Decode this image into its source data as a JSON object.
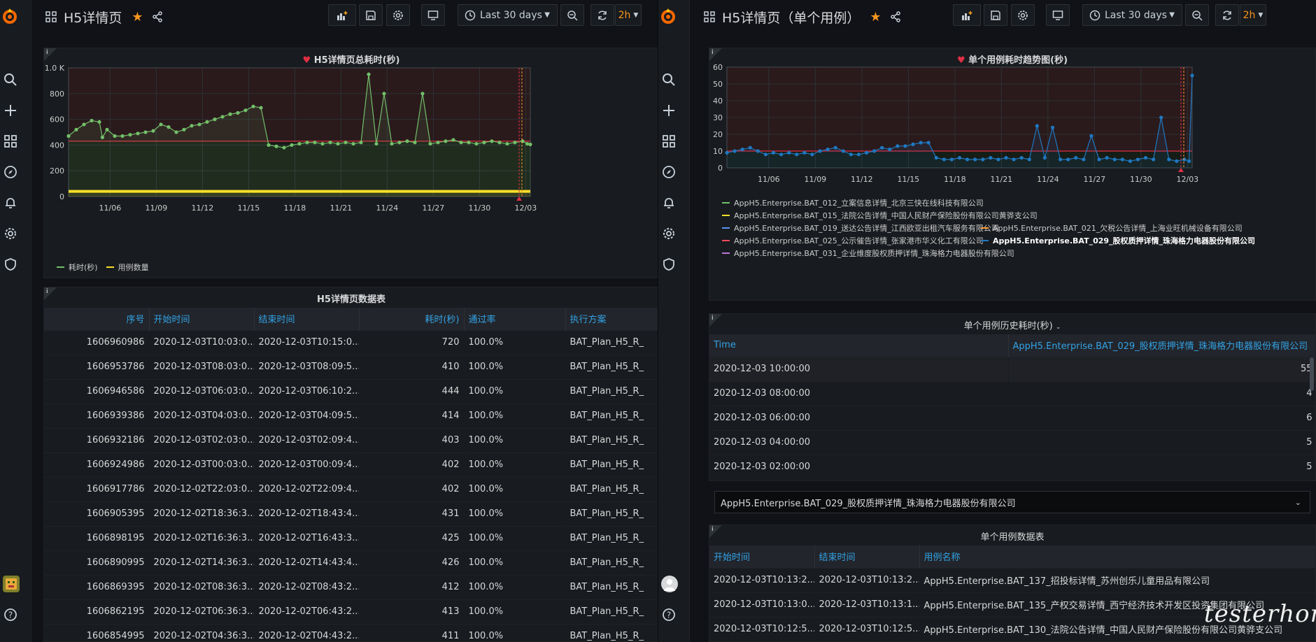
{
  "left": {
    "title": "H5详情页",
    "time_range": "Last 30 days",
    "refresh": "2h",
    "chart1": {
      "title": "H5详情页总耗时(秒)",
      "chart_data": {
        "type": "line",
        "title": "H5详情页总耗时(秒)",
        "x_ticks": [
          "11/06",
          "11/09",
          "11/12",
          "11/15",
          "11/18",
          "11/21",
          "11/24",
          "11/27",
          "11/30",
          "12/03"
        ],
        "y_ticks": [
          "0",
          "200",
          "400",
          "600",
          "800",
          "1.0 K"
        ],
        "ylim": [
          0,
          1000
        ],
        "threshold": 430,
        "series": [
          {
            "name": "耗时(秒)",
            "color": "#73bf69",
            "x": [
              0,
              0.5,
              1,
              1.5,
              2,
              2.2,
              2.5,
              3,
              3.5,
              4,
              4.5,
              5,
              5.5,
              6,
              6.5,
              7,
              7.5,
              8,
              8.5,
              9,
              9.5,
              10,
              10.5,
              11,
              11.5,
              12,
              12.5,
              13,
              13.5,
              14,
              14.5,
              15,
              15.5,
              16,
              16.5,
              17,
              17.5,
              18,
              18.5,
              19,
              19.5,
              20,
              20.5,
              21,
              21.5,
              22,
              22.5,
              23,
              23.5,
              24,
              24.5,
              25,
              25.5,
              26,
              26.5,
              27,
              27.5,
              28,
              28.5,
              29,
              29.5,
              29.8,
              30
            ],
            "values": [
              470,
              520,
              560,
              590,
              580,
              460,
              520,
              470,
              470,
              480,
              490,
              500,
              510,
              560,
              540,
              500,
              520,
              550,
              560,
              580,
              600,
              620,
              640,
              650,
              670,
              700,
              690,
              400,
              390,
              380,
              400,
              410,
              420,
              420,
              410,
              420,
              410,
              420,
              410,
              420,
              950,
              410,
              800,
              410,
              420,
              430,
              420,
              800,
              410,
              420,
              430,
              440,
              420,
              420,
              410,
              420,
              430,
              420,
              410,
              420,
              430,
              410,
              405
            ]
          },
          {
            "name": "用例数量",
            "color": "#fade2a",
            "x": [
              0,
              30
            ],
            "values": [
              40,
              40
            ]
          }
        ]
      },
      "legend": [
        "耗时(秒)",
        "用例数量"
      ]
    },
    "table": {
      "title": "H5详情页数据表",
      "headers": [
        "序号",
        "开始时间",
        "结束时间",
        "耗时(秒)",
        "通过率",
        "执行方案"
      ],
      "rows": [
        [
          "1606960986",
          "2020-12-03T10:03:0...",
          "2020-12-03T10:15:0...",
          "720",
          "100.0%",
          "BAT_Plan_H5_R_"
        ],
        [
          "1606953786",
          "2020-12-03T08:03:0...",
          "2020-12-03T08:09:5...",
          "410",
          "100.0%",
          "BAT_Plan_H5_R_"
        ],
        [
          "1606946586",
          "2020-12-03T06:03:0...",
          "2020-12-03T06:10:2...",
          "444",
          "100.0%",
          "BAT_Plan_H5_R_"
        ],
        [
          "1606939386",
          "2020-12-03T04:03:0...",
          "2020-12-03T04:09:5...",
          "414",
          "100.0%",
          "BAT_Plan_H5_R_"
        ],
        [
          "1606932186",
          "2020-12-03T02:03:0...",
          "2020-12-03T02:09:4...",
          "403",
          "100.0%",
          "BAT_Plan_H5_R_"
        ],
        [
          "1606924986",
          "2020-12-03T00:03:0...",
          "2020-12-03T00:09:4...",
          "402",
          "100.0%",
          "BAT_Plan_H5_R_"
        ],
        [
          "1606917786",
          "2020-12-02T22:03:0...",
          "2020-12-02T22:09:4...",
          "402",
          "100.0%",
          "BAT_Plan_H5_R_"
        ],
        [
          "1606905395",
          "2020-12-02T18:36:3...",
          "2020-12-02T18:43:4...",
          "431",
          "100.0%",
          "BAT_Plan_H5_R_"
        ],
        [
          "1606898195",
          "2020-12-02T16:36:3...",
          "2020-12-02T16:43:3...",
          "425",
          "100.0%",
          "BAT_Plan_H5_R_"
        ],
        [
          "1606890995",
          "2020-12-02T14:36:3...",
          "2020-12-02T14:43:4...",
          "426",
          "100.0%",
          "BAT_Plan_H5_R_"
        ],
        [
          "1606869395",
          "2020-12-02T08:36:3...",
          "2020-12-02T08:43:2...",
          "412",
          "100.0%",
          "BAT_Plan_H5_R_"
        ],
        [
          "1606862195",
          "2020-12-02T06:36:3...",
          "2020-12-02T06:43:2...",
          "413",
          "100.0%",
          "BAT_Plan_H5_R_"
        ],
        [
          "1606854995",
          "2020-12-02T04:36:3...",
          "2020-12-02T04:43:2...",
          "411",
          "100.0%",
          "BAT_Plan_H5_R_"
        ]
      ]
    }
  },
  "right": {
    "title": "H5详情页（单个用例）",
    "time_range": "Last 30 days",
    "refresh": "2h",
    "chart1": {
      "title": "单个用例耗时趋势图(秒)",
      "chart_data": {
        "type": "line",
        "title": "单个用例耗时趋势图(秒)",
        "x_ticks": [
          "11/06",
          "11/09",
          "11/12",
          "11/15",
          "11/18",
          "11/21",
          "11/24",
          "11/27",
          "11/30",
          "12/03"
        ],
        "y_ticks": [
          "0",
          "10",
          "20",
          "30",
          "40",
          "50",
          "60"
        ],
        "ylim": [
          0,
          60
        ],
        "threshold": 10,
        "series": [
          {
            "name": "AppH5.Enterprise.BAT_029_股权质押详情_珠海格力电器股份有限公司",
            "color": "#1f78c1",
            "x": [
              0,
              0.5,
              1,
              1.5,
              2,
              2.5,
              3,
              3.5,
              4,
              4.5,
              5,
              5.5,
              6,
              6.5,
              7,
              7.5,
              8,
              8.5,
              9,
              9.5,
              10,
              10.5,
              11,
              11.5,
              12,
              12.5,
              13,
              13.5,
              14,
              14.5,
              15,
              15.5,
              16,
              16.5,
              17,
              17.5,
              18,
              18.5,
              19,
              19.5,
              20,
              20.5,
              21,
              21.5,
              22,
              22.5,
              23,
              23.5,
              24,
              24.5,
              25,
              25.5,
              26,
              26.5,
              27,
              27.5,
              28,
              28.5,
              29,
              29.5,
              29.8,
              30
            ],
            "values": [
              9,
              10,
              11,
              12,
              10,
              8,
              9,
              8,
              9,
              8,
              9,
              8,
              10,
              11,
              12,
              10,
              8,
              8,
              9,
              10,
              12,
              11,
              13,
              13,
              14,
              15,
              15,
              6,
              5,
              5,
              6,
              5,
              5,
              5,
              6,
              5,
              6,
              5,
              6,
              5,
              25,
              6,
              24,
              5,
              5,
              6,
              5,
              19,
              5,
              6,
              5,
              5,
              4,
              5,
              6,
              5,
              30,
              5,
              4,
              5,
              4,
              55
            ]
          }
        ]
      },
      "legend": [
        {
          "label": "AppH5.Enterprise.BAT_012_立案信息详情_北京三快在线科技有限公司",
          "color": "#73bf69"
        },
        {
          "label": "AppH5.Enterprise.BAT_015_法院公告详情_中国人民财产保险股份有限公司黄骅支公司",
          "color": "#fade2a"
        },
        {
          "label": "AppH5.Enterprise.BAT_019_送达公告详情_江西欧亚出租汽车服务有限公司",
          "color": "#5794f2"
        },
        {
          "label": "AppH5.Enterprise.BAT_021_欠税公告详情_上海业旺机械设备有限公司",
          "color": "#ff9830"
        },
        {
          "label": "AppH5.Enterprise.BAT_025_公示催告详情_张家港市华义化工有限公司",
          "color": "#f2495c"
        },
        {
          "label": "AppH5.Enterprise.BAT_029_股权质押详情_珠海格力电器股份有限公司",
          "color": "#1f78c1"
        },
        {
          "label": "AppH5.Enterprise.BAT_031_企业维度股权质押详情_珠海格力电器股份有限公司",
          "color": "#b877d9"
        }
      ]
    },
    "history": {
      "title": "单个用例历史耗时(秒)",
      "headers": [
        "Time",
        "AppH5.Enterprise.BAT_029_股权质押详情_珠海格力电器股份有限公司"
      ],
      "rows": [
        [
          "2020-12-03 10:00:00",
          "55"
        ],
        [
          "2020-12-03 08:00:00",
          "4"
        ],
        [
          "2020-12-03 06:00:00",
          "6"
        ],
        [
          "2020-12-03 04:00:00",
          "5"
        ],
        [
          "2020-12-03 02:00:00",
          "5"
        ]
      ]
    },
    "select_value": "AppH5.Enterprise.BAT_029_股权质押详情_珠海格力电器股份有限公司",
    "table": {
      "title": "单个用例数据表",
      "headers": [
        "开始时间",
        "结束时间",
        "用例名称"
      ],
      "rows": [
        [
          "2020-12-03T10:13:2...",
          "2020-12-03T10:13:2...",
          "AppH5.Enterprise.BAT_137_招投标详情_苏州创乐儿童用品有限公司"
        ],
        [
          "2020-12-03T10:13:0...",
          "2020-12-03T10:13:1...",
          "AppH5.Enterprise.BAT_135_产权交易详情_西宁经济技术开发区投资集团有限公司"
        ],
        [
          "2020-12-03T10:12:5...",
          "2020-12-03T10:12:5...",
          "AppH5.Enterprise.BAT_130_法院公告详情_中国人民财产保险股份有限公司黄骅支公司"
        ]
      ]
    },
    "watermark": "testerhome.com"
  }
}
